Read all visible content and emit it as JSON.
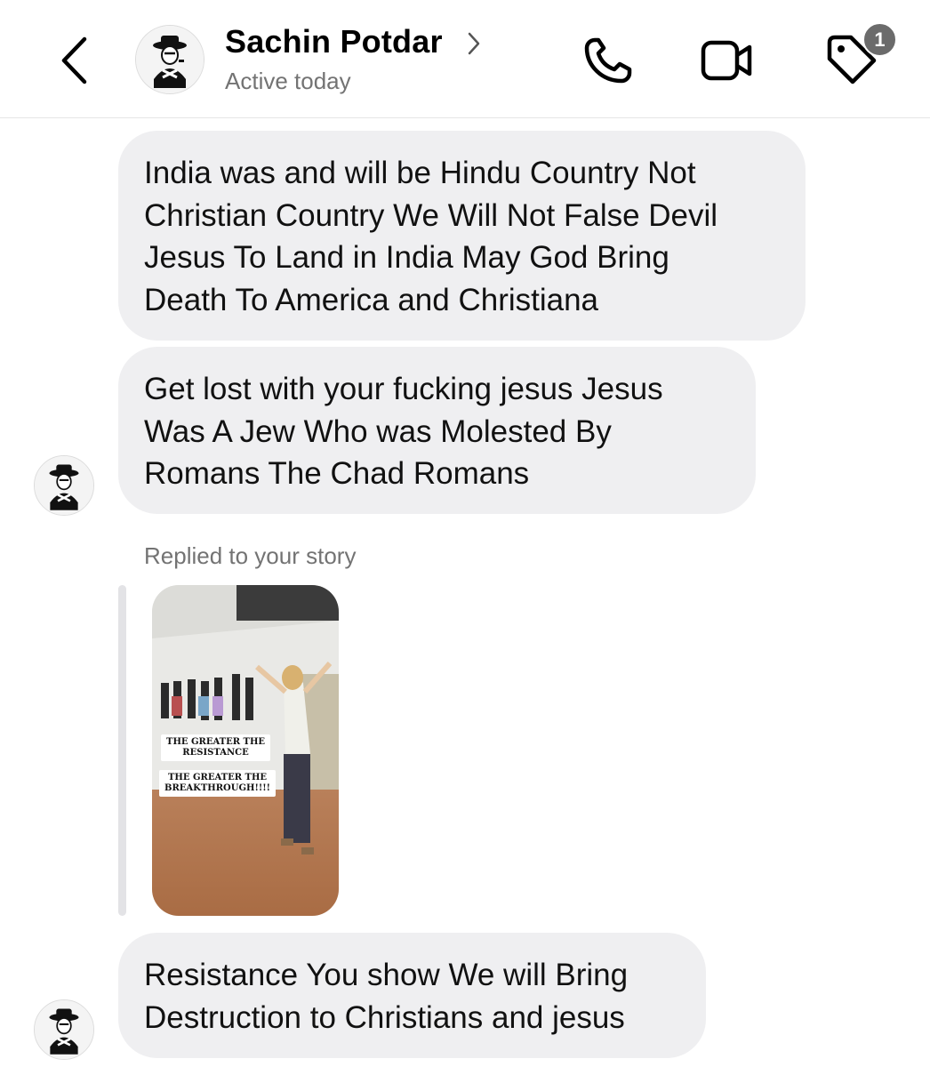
{
  "header": {
    "contact_name": "Sachin Potdar",
    "status": "Active today",
    "badge_count": "1",
    "icons": [
      "back-chevron-icon",
      "chevron-right-icon",
      "phone-icon",
      "video-camera-icon",
      "tag-icon"
    ]
  },
  "messages": [
    {
      "lines": [
        "India was and will be Hindu Country Not",
        "Christian Country We Will Not False Devil",
        "Jesus To Land in India May God Bring",
        "Death To America and Christiana"
      ]
    },
    {
      "lines": [
        "Get lost with your fucking jesus Jesus",
        "Was A Jew Who was Molested By",
        "Romans The Chad Romans"
      ]
    },
    {
      "lines": [
        "Resistance You show We will Bring",
        "Destruction to Christians and jesus"
      ]
    }
  ],
  "story_reply": {
    "label": "Replied to your story",
    "caption_1": [
      "THE GREATER THE",
      "RESISTANCE"
    ],
    "caption_2": [
      "THE GREATER THE",
      "BREAKTHROUGH!!!!"
    ]
  },
  "colors": {
    "bubble_background": "#efeff1",
    "secondary_text": "#737373",
    "badge_background": "#6b6b6b"
  }
}
